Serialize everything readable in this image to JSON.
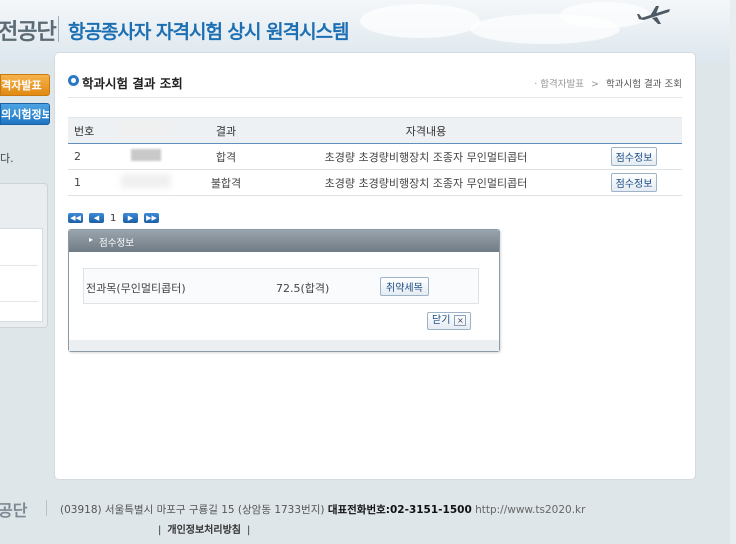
{
  "header": {
    "org_name": "전공단",
    "system_title": "항공종사자 자격시험 상시 원격시스템"
  },
  "left_nav": {
    "btn_results": "합격자발표",
    "btn_exam_info": "나의시험정보",
    "notice_text": "다."
  },
  "page": {
    "title": "학과시험 결과 조회",
    "breadcrumb": {
      "parent": "합격자발표",
      "separator": ">",
      "current": "학과시험 결과 조회"
    }
  },
  "table": {
    "headers": {
      "no": "번호",
      "result": "결과",
      "qualification": "자격내용"
    },
    "rows": [
      {
        "no": "2",
        "result": "합격",
        "qualification": "초경량 초경량비행장치 조종자 무인멀티콥터",
        "button": "점수정보"
      },
      {
        "no": "1",
        "result": "불합격",
        "qualification": "초경량 초경량비행장치 조종자 무인멀티콥터",
        "button": "점수정보"
      }
    ]
  },
  "pager": {
    "current_page": "1",
    "first": "◀◀",
    "prev": "◀",
    "next": "▶",
    "last": "▶▶"
  },
  "popup": {
    "title": "점수정보",
    "subject": "전과목(무인멀티콥터)",
    "score": "72.5(합격)",
    "weak_button": "취약세목",
    "close_button": "닫기",
    "close_icon": "×"
  },
  "footer": {
    "org_name": "공단",
    "address": "(03918) 서울특별시 마포구 구룡길 15 (상암동 1733번지)",
    "phone_label": "대표전화번호:02-3151-1500",
    "url": "http://www.ts2020.kr",
    "privacy_link": "개인정보처리방침",
    "privacy_bar_left": "|",
    "privacy_bar_right": "|"
  },
  "colors": {
    "accent_blue": "#1d6fb4",
    "orange": "#e08a12"
  }
}
